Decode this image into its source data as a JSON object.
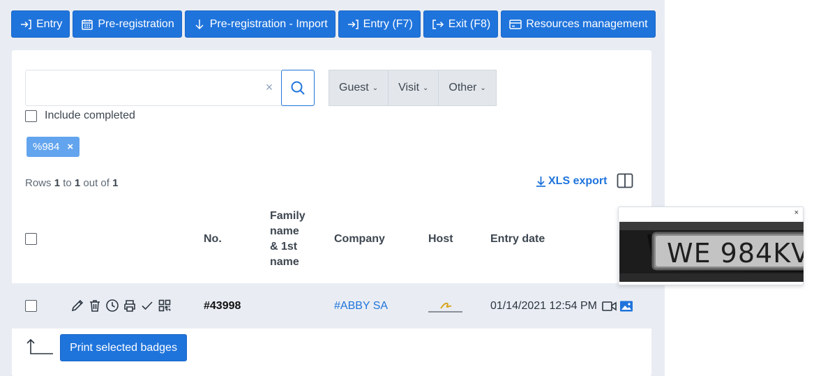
{
  "toolbar": {
    "buttons": [
      {
        "label": "Entry",
        "icon": "login-arrow-icon"
      },
      {
        "label": "Pre-registration",
        "icon": "calendar-icon"
      },
      {
        "label": "Pre-registration - Import",
        "icon": "arrow-down-icon"
      },
      {
        "label": "Entry (F7)",
        "icon": "login-arrow-icon"
      },
      {
        "label": "Exit (F8)",
        "icon": "logout-arrow-icon"
      },
      {
        "label": "Resources management",
        "icon": "card-icon"
      }
    ]
  },
  "search": {
    "value": "",
    "placeholder": "",
    "clear_glyph": "×"
  },
  "filters": [
    {
      "label": "Guest"
    },
    {
      "label": "Visit"
    },
    {
      "label": "Other"
    }
  ],
  "include_completed": {
    "label": "Include completed",
    "checked": false
  },
  "active_tag": {
    "label": "%984",
    "remove_glyph": "×"
  },
  "rows_info": {
    "prefix": "Rows",
    "from": "1",
    "to_word": "to",
    "to": "1",
    "out_of_word": "out of",
    "total": "1"
  },
  "export": {
    "label": "XLS export"
  },
  "table": {
    "headers": {
      "no": "No.",
      "name_line1": "Family",
      "name_line2": "name",
      "name_line3": "& 1st",
      "name_line4": "name",
      "company": "Company",
      "host": "Host",
      "entry_date": "Entry date"
    },
    "rows": [
      {
        "no": "#43998",
        "name": "",
        "company": "#ABBY SA",
        "host": "",
        "entry_date": "01/14/2021 12:54 PM",
        "selected": false
      }
    ]
  },
  "print_button": {
    "label": "Print selected badges"
  },
  "photo_popup": {
    "close_glyph": "×",
    "plate_text": "WE 984KV"
  },
  "colors": {
    "primary": "#1f74dc",
    "tag": "#63a4ee",
    "panel_bg": "#e9edf3",
    "text": "#3d4650"
  }
}
